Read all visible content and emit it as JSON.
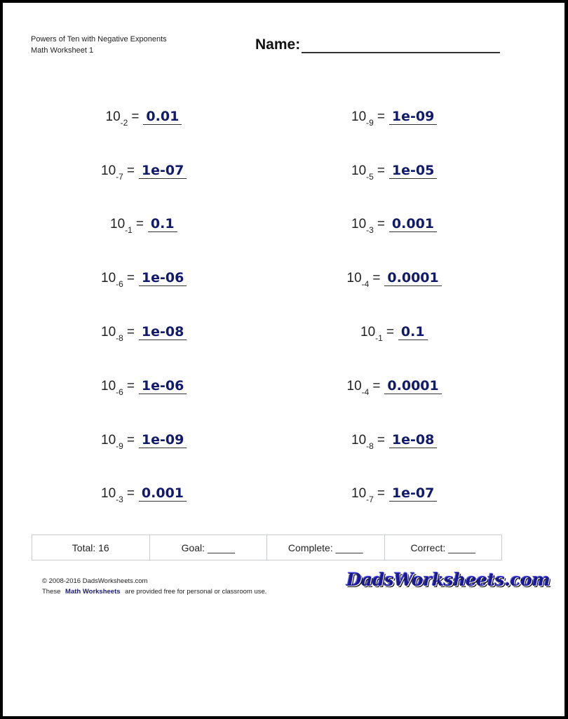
{
  "header": {
    "title": "Powers of Ten with Negative Exponents",
    "subtitle": "Math Worksheet 1",
    "name_label": "Name:"
  },
  "problems": [
    {
      "base": "10",
      "exp": "-2",
      "eq": "=",
      "answer": "0.01"
    },
    {
      "base": "10",
      "exp": "-9",
      "eq": "=",
      "answer": "1e-09"
    },
    {
      "base": "10",
      "exp": "-7",
      "eq": "=",
      "answer": "1e-07"
    },
    {
      "base": "10",
      "exp": "-5",
      "eq": "=",
      "answer": "1e-05"
    },
    {
      "base": "10",
      "exp": "-1",
      "eq": "=",
      "answer": "0.1"
    },
    {
      "base": "10",
      "exp": "-3",
      "eq": "=",
      "answer": "0.001"
    },
    {
      "base": "10",
      "exp": "-6",
      "eq": "=",
      "answer": "1e-06"
    },
    {
      "base": "10",
      "exp": "-4",
      "eq": "=",
      "answer": "0.0001"
    },
    {
      "base": "10",
      "exp": "-8",
      "eq": "=",
      "answer": "1e-08"
    },
    {
      "base": "10",
      "exp": "-1",
      "eq": "=",
      "answer": "0.1"
    },
    {
      "base": "10",
      "exp": "-6",
      "eq": "=",
      "answer": "1e-06"
    },
    {
      "base": "10",
      "exp": "-4",
      "eq": "=",
      "answer": "0.0001"
    },
    {
      "base": "10",
      "exp": "-9",
      "eq": "=",
      "answer": "1e-09"
    },
    {
      "base": "10",
      "exp": "-8",
      "eq": "=",
      "answer": "1e-08"
    },
    {
      "base": "10",
      "exp": "-3",
      "eq": "=",
      "answer": "0.001"
    },
    {
      "base": "10",
      "exp": "-7",
      "eq": "=",
      "answer": "1e-07"
    }
  ],
  "score_table": {
    "total": "Total: 16",
    "goal": "Goal: _____",
    "complete": "Complete: _____",
    "correct": "Correct: _____"
  },
  "footer": {
    "copyright": "© 2008-2016 DadsWorksheets.com",
    "line2_prefix": "These",
    "line2_link": "Math Worksheets",
    "line2_suffix": "are provided free for personal or classroom use.",
    "logo_text": "DadsWorksheets.com"
  }
}
